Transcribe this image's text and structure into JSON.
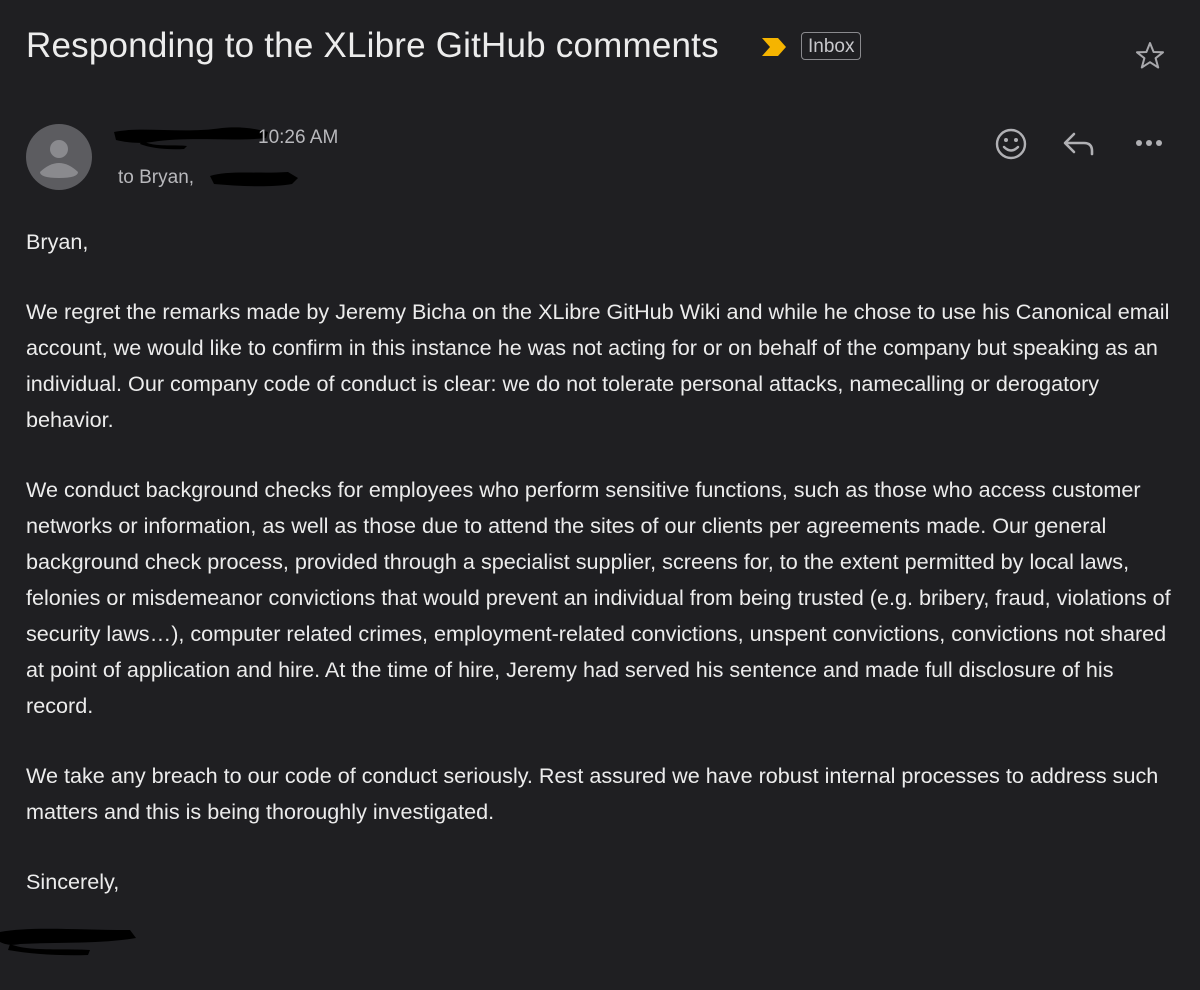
{
  "header": {
    "subject": "Responding to the XLibre GitHub comments",
    "label": "Inbox",
    "importance_color": "#f5b400"
  },
  "message": {
    "sender_name": "[redacted]",
    "time": "10:26 AM",
    "recipients": "to Bryan,",
    "greeting": "Bryan,",
    "paragraphs": [
      "We regret the remarks made by Jeremy Bicha on the XLibre GitHub Wiki and while he chose to use his Canonical email account, we would like to confirm in this instance he was not acting for or on behalf of the company but speaking as an individual. Our company code of conduct is clear: we do not tolerate personal attacks, namecalling or derogatory behavior.",
      "We conduct background checks for employees who perform sensitive functions, such as those who access customer networks or information, as well as those due to attend the sites of our clients per agreements made. Our general background check process, provided through a specialist supplier, screens for, to the extent permitted by local laws, felonies or misdemeanor convictions that would prevent an individual from being trusted (e.g. bribery, fraud, violations of security laws…), computer related crimes, employment-related convictions, unspent convictions, convictions not shared at point of application and hire. At the time of hire, Jeremy had served his sentence and made full disclosure of his record.",
      "We take any breach to our code of conduct seriously. Rest assured we have robust internal processes to address such matters and this is being thoroughly investigated."
    ],
    "closing": "Sincerely,"
  },
  "icons": {
    "star": "star-icon",
    "emoji": "emoji-icon",
    "reply": "reply-icon",
    "more": "more-icon"
  }
}
